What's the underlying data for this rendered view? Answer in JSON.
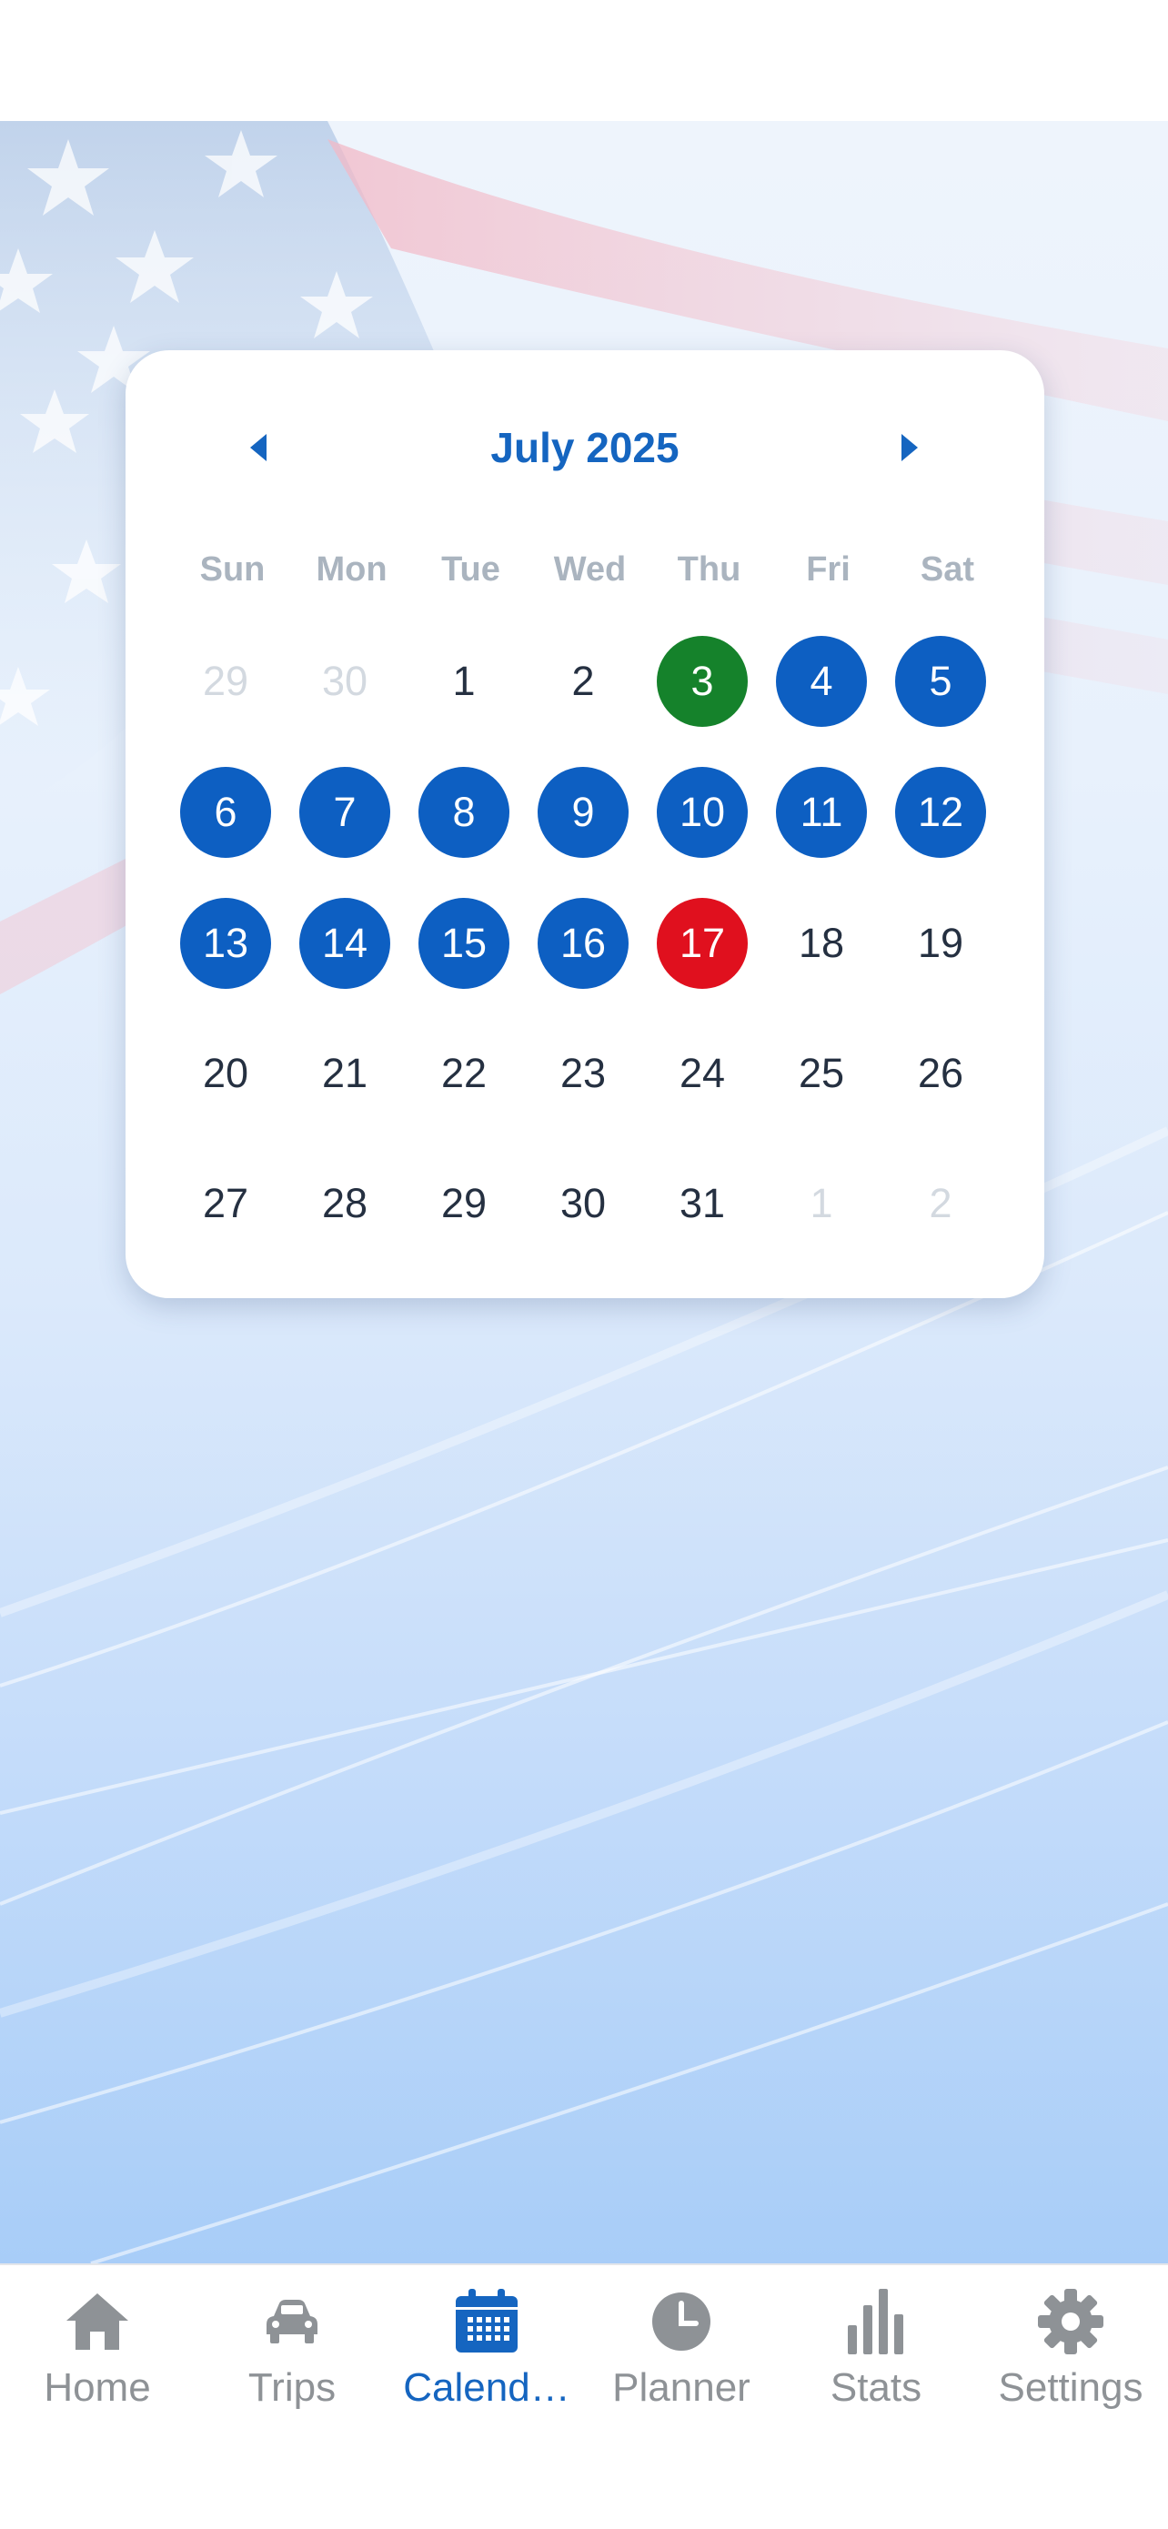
{
  "colors": {
    "accent": "#1565c0",
    "event_blue": "#0d5fc2",
    "today_green": "#15822b",
    "selected_red": "#e0101e",
    "inactive_gray": "#8e9296"
  },
  "calendar": {
    "month_title": "July 2025",
    "prev_icon": "caret-left-icon",
    "next_icon": "caret-right-icon",
    "weekdays": [
      "Sun",
      "Mon",
      "Tue",
      "Wed",
      "Thu",
      "Fri",
      "Sat"
    ],
    "weeks": [
      [
        {
          "label": "29",
          "outside": true
        },
        {
          "label": "30",
          "outside": true
        },
        {
          "label": "1"
        },
        {
          "label": "2"
        },
        {
          "label": "3",
          "status": "today"
        },
        {
          "label": "4",
          "status": "event"
        },
        {
          "label": "5",
          "status": "event"
        }
      ],
      [
        {
          "label": "6",
          "status": "event"
        },
        {
          "label": "7",
          "status": "event"
        },
        {
          "label": "8",
          "status": "event"
        },
        {
          "label": "9",
          "status": "event"
        },
        {
          "label": "10",
          "status": "event"
        },
        {
          "label": "11",
          "status": "event"
        },
        {
          "label": "12",
          "status": "event"
        }
      ],
      [
        {
          "label": "13",
          "status": "event"
        },
        {
          "label": "14",
          "status": "event"
        },
        {
          "label": "15",
          "status": "event"
        },
        {
          "label": "16",
          "status": "event"
        },
        {
          "label": "17",
          "status": "selected"
        },
        {
          "label": "18"
        },
        {
          "label": "19"
        }
      ],
      [
        {
          "label": "20"
        },
        {
          "label": "21"
        },
        {
          "label": "22"
        },
        {
          "label": "23"
        },
        {
          "label": "24"
        },
        {
          "label": "25"
        },
        {
          "label": "26"
        }
      ],
      [
        {
          "label": "27"
        },
        {
          "label": "28"
        },
        {
          "label": "29"
        },
        {
          "label": "30"
        },
        {
          "label": "31"
        },
        {
          "label": "1",
          "outside": true
        },
        {
          "label": "2",
          "outside": true
        }
      ]
    ]
  },
  "tab_bar": {
    "tabs": [
      {
        "label": "Home",
        "icon": "home-icon",
        "active": false
      },
      {
        "label": "Trips",
        "icon": "car-icon",
        "active": false
      },
      {
        "label": "Calend…",
        "icon": "calendar-icon",
        "active": true
      },
      {
        "label": "Planner",
        "icon": "clock-icon",
        "active": false
      },
      {
        "label": "Stats",
        "icon": "bar-chart-icon",
        "active": false
      },
      {
        "label": "Settings",
        "icon": "gear-icon",
        "active": false
      }
    ]
  }
}
